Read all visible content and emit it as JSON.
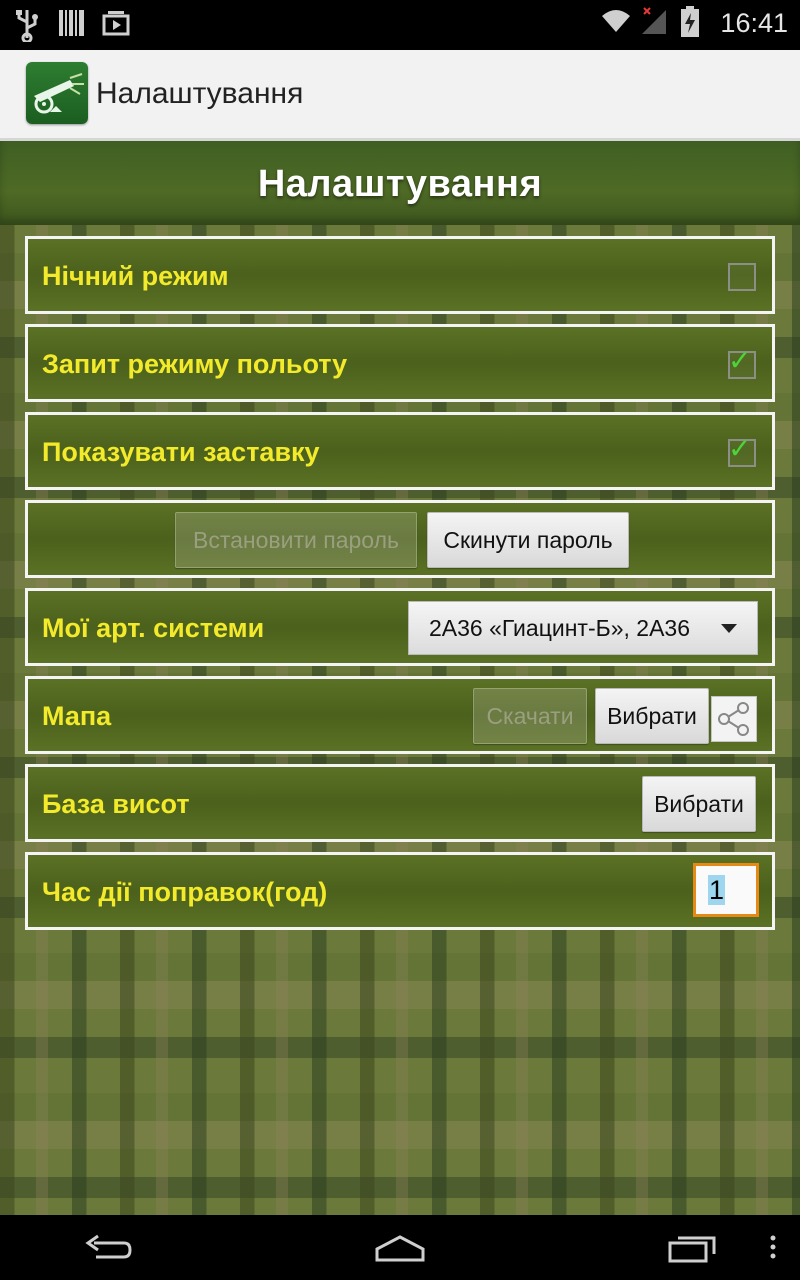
{
  "status_bar": {
    "time": "16:41",
    "left_icons": [
      "usb-icon",
      "barcode-icon",
      "video-store-icon"
    ],
    "right_icons": [
      "wifi-icon",
      "signal-icon",
      "battery-charging-icon"
    ]
  },
  "action_bar": {
    "title": "Налаштування",
    "app_icon": "cannon-app-icon"
  },
  "header": {
    "title": "Налаштування"
  },
  "settings": {
    "night_mode": {
      "label": "Нічний режим",
      "checked": false
    },
    "flight_mode_request": {
      "label": "Запит режиму польоту",
      "checked": true
    },
    "show_splash": {
      "label": "Показувати заставку",
      "checked": true
    },
    "password": {
      "set_label": "Встановити пароль",
      "reset_label": "Скинути пароль"
    },
    "art_systems": {
      "label": "Мої арт. системи",
      "selected": "2А36 «Гиацинт-Б», 2А36"
    },
    "map": {
      "label": "Мапа",
      "download_label": "Скачати",
      "choose_label": "Вибрати"
    },
    "height_base": {
      "label": "База висот",
      "choose_label": "Вибрати"
    },
    "correction_time": {
      "label": "Час дії поправок(год)",
      "value": "1"
    }
  },
  "colors": {
    "label_yellow": "#f2ea2a",
    "row_green": "#4b611c",
    "focus_orange": "#e58a16",
    "check_green": "#4cd43a"
  },
  "nav_bar": [
    "back-icon",
    "home-icon",
    "recent-apps-icon",
    "menu-icon"
  ]
}
